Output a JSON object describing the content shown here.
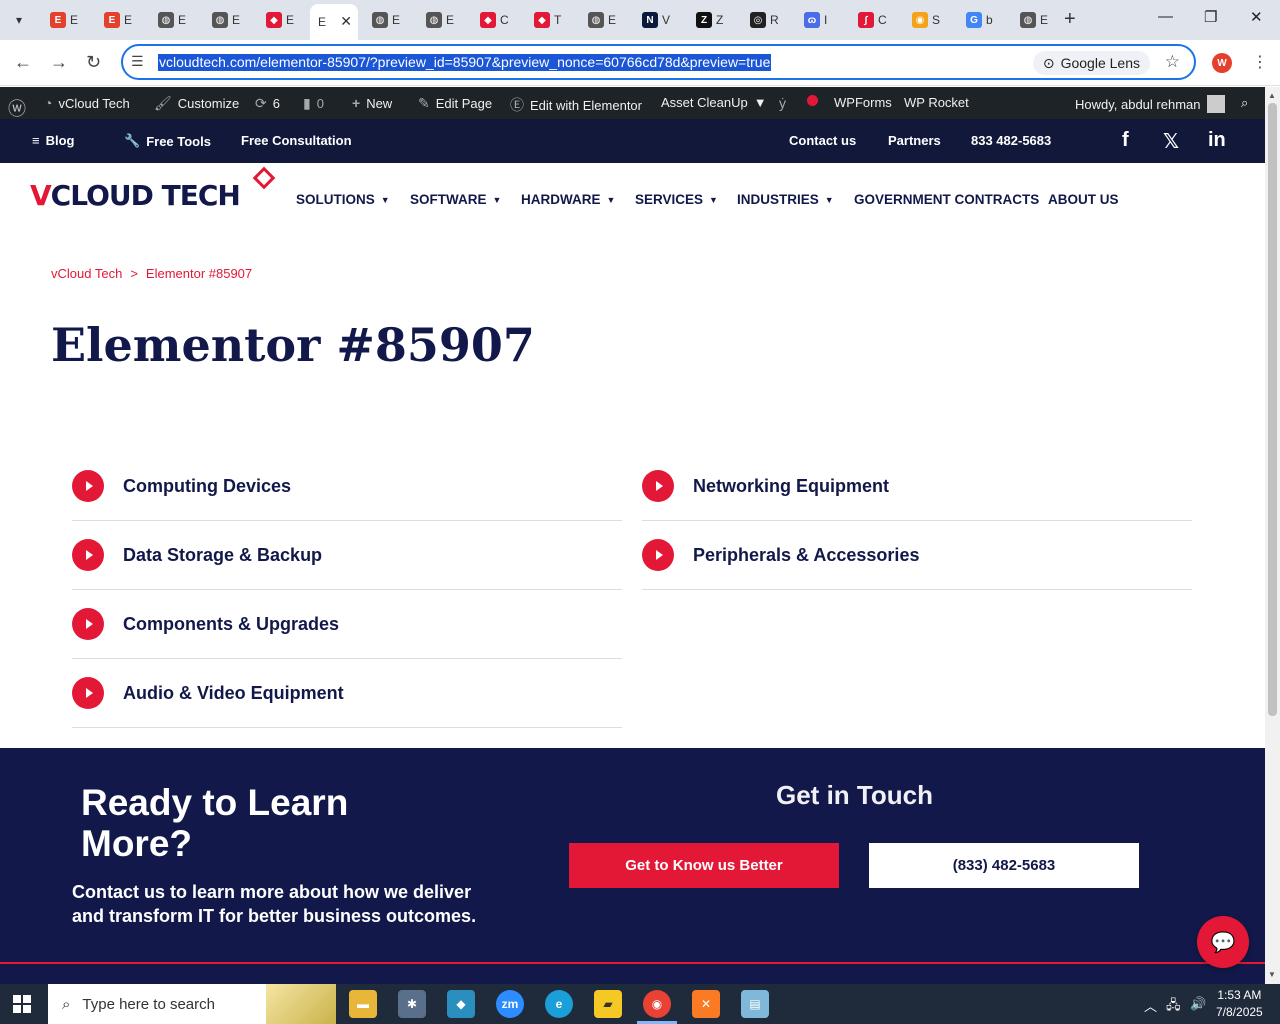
{
  "browser": {
    "tabs": [
      {
        "label": "E",
        "favicon": "E",
        "color": "#e5402b"
      },
      {
        "label": "E",
        "favicon": "E",
        "color": "#e5402b"
      },
      {
        "label": "E",
        "favicon": "◍",
        "color": "#555555"
      },
      {
        "label": "E",
        "favicon": "◍",
        "color": "#555555"
      },
      {
        "label": "E",
        "favicon": "◆",
        "color": "#e31837"
      },
      {
        "label": "E",
        "favicon": "",
        "color": "#ffffff"
      },
      {
        "label": "E",
        "favicon": "◍",
        "color": "#555555"
      },
      {
        "label": "E",
        "favicon": "◍",
        "color": "#555555"
      },
      {
        "label": "C",
        "favicon": "◆",
        "color": "#e31837"
      },
      {
        "label": "T",
        "favicon": "◆",
        "color": "#e31837"
      },
      {
        "label": "E",
        "favicon": "◍",
        "color": "#555555"
      },
      {
        "label": "V",
        "favicon": "N",
        "color": "#0b1a3c"
      },
      {
        "label": "Z",
        "favicon": "Z",
        "color": "#111111"
      },
      {
        "label": "R",
        "favicon": "◎",
        "color": "#222222"
      },
      {
        "label": "I",
        "favicon": "ɷ",
        "color": "#4a6de5"
      },
      {
        "label": "C",
        "favicon": "∫",
        "color": "#e31837"
      },
      {
        "label": "S",
        "favicon": "◉",
        "color": "#f4a21a"
      },
      {
        "label": "b",
        "favicon": "G",
        "color": "#4285f4"
      },
      {
        "label": "E",
        "favicon": "◍",
        "color": "#555555"
      }
    ],
    "url": "vcloudtech.com/elementor-85907/?preview_id=85907&preview_nonce=60766cd78d&preview=true",
    "lens_label": "Google Lens",
    "profile_initial": "W"
  },
  "wp_admin": {
    "site": "vCloud Tech",
    "customize": "Customize",
    "updates": "6",
    "comments": "0",
    "new": "New",
    "edit_page": "Edit Page",
    "elementor": "Edit with Elementor",
    "asset_cleanup": "Asset CleanUp",
    "wpforms": "WPForms",
    "wprocket": "WP Rocket",
    "howdy": "Howdy, abdul rehman"
  },
  "topbar": {
    "blog": "Blog",
    "free_tools": "Free Tools",
    "free_consultation": "Free Consultation",
    "contact": "Contact us",
    "partners": "Partners",
    "phone": "833 482-5683"
  },
  "header": {
    "logo_v": "V",
    "logo_rest": "CLOUD TECH",
    "menu": [
      "SOLUTIONS",
      "SOFTWARE",
      "HARDWARE",
      "SERVICES",
      "INDUSTRIES",
      "GOVERNMENT CONTRACTS",
      "ABOUT US"
    ]
  },
  "content": {
    "breadcrumb_home": "vCloud Tech",
    "breadcrumb_sep": ">",
    "breadcrumb_current": "Elementor #85907",
    "title": "Elementor #85907",
    "left_items": [
      "Computing Devices",
      "Data Storage & Backup",
      "Components & Upgrades",
      "Audio & Video Equipment"
    ],
    "right_items": [
      "Networking Equipment",
      "Peripherals & Accessories"
    ]
  },
  "cta": {
    "title": "Ready to Learn More?",
    "text": "Contact us to learn more about how we deliver and transform IT for better business outcomes.",
    "subtitle": "Get in Touch",
    "button_primary": "Get to Know us Better",
    "button_phone": "(833) 482-5683"
  },
  "taskbar": {
    "search_placeholder": "Type here to search",
    "time": "1:53 AM",
    "date": "7/8/2025"
  }
}
